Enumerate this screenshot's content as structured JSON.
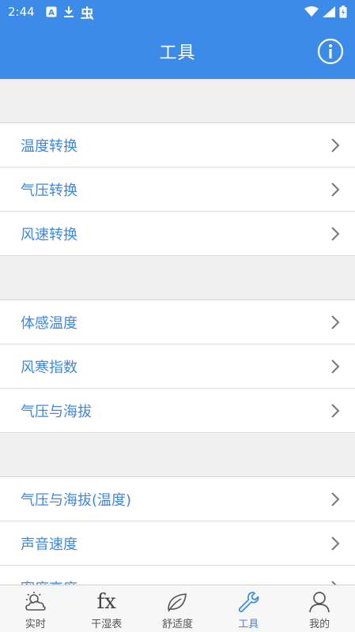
{
  "status_bar": {
    "time": "2:44",
    "bug_glyph": "虫"
  },
  "app_bar": {
    "title": "工具"
  },
  "sections": [
    {
      "items": [
        {
          "label": "温度转换"
        },
        {
          "label": "气压转换"
        },
        {
          "label": "风速转换"
        }
      ]
    },
    {
      "items": [
        {
          "label": "体感温度"
        },
        {
          "label": "风寒指数"
        },
        {
          "label": "气压与海拔"
        }
      ]
    },
    {
      "items": [
        {
          "label": "气压与海拔(温度)"
        },
        {
          "label": "声音速度"
        },
        {
          "label": "密度高度"
        }
      ]
    }
  ],
  "bottom_nav": {
    "items": [
      {
        "label": "实时",
        "icon": "weather-icon"
      },
      {
        "label": "干湿表",
        "icon": "fx-icon",
        "icon_text": "fx"
      },
      {
        "label": "舒适度",
        "icon": "leaf-icon"
      },
      {
        "label": "工具",
        "icon": "wrench-icon",
        "active": true
      },
      {
        "label": "我的",
        "icon": "person-icon"
      }
    ],
    "active_color": "#3d88df"
  },
  "colors": {
    "primary": "#3c8be8",
    "item_text": "#3d88df",
    "background": "#efefef"
  }
}
